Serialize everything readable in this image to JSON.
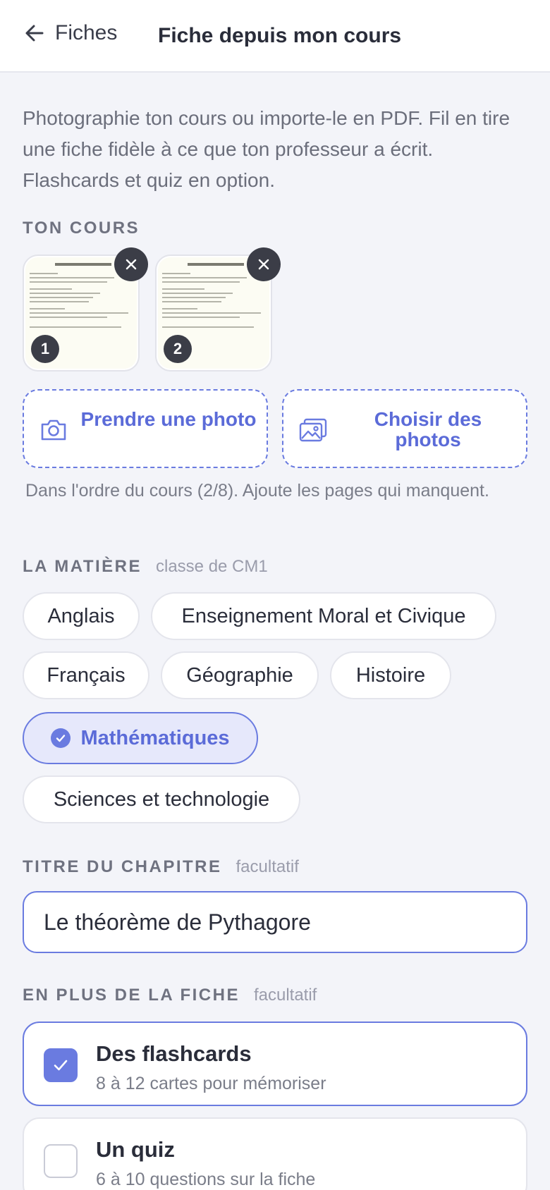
{
  "header": {
    "back_label": "Fiches",
    "title": "Fiche depuis mon cours"
  },
  "intro": "Photographie ton cours ou importe-le en PDF. Fil en tire une fiche fidèle à ce que ton professeur a écrit. Flashcards et quiz en option.",
  "course": {
    "label": "TON COURS",
    "pages": [
      {
        "number": "1",
        "doc_title": "Chapitre 5 : Le théorème de Pythagore"
      },
      {
        "number": "2",
        "doc_title": "Chapitre 5 : Le théorème de Pythagore"
      }
    ],
    "take_photo_label": "Prendre une photo",
    "choose_photos_label": "Choisir des photos",
    "order_note": "Dans l'ordre du cours (2/8). Ajoute les pages qui manquent."
  },
  "subject": {
    "label": "LA MATIÈRE",
    "hint": "classe de CM1",
    "options": [
      "Anglais",
      "Enseignement Moral et Civique",
      "Français",
      "Géographie",
      "Histoire",
      "Mathématiques",
      "Sciences et technologie"
    ],
    "selected": "Mathématiques"
  },
  "chapter": {
    "label": "TITRE DU CHAPITRE",
    "hint": "facultatif",
    "value": "Le théorème de Pythagore"
  },
  "extras": {
    "label": "EN PLUS DE LA FICHE",
    "hint": "facultatif",
    "options": [
      {
        "title": "Des flashcards",
        "subtitle": "8 à 12 cartes pour mémoriser",
        "checked": true
      },
      {
        "title": "Un quiz",
        "subtitle": "6 à 10 questions sur la fiche",
        "checked": false
      }
    ]
  },
  "colors": {
    "accent": "#6a7be0",
    "background": "#f3f4f9",
    "dark_badge": "#3b3d47"
  }
}
